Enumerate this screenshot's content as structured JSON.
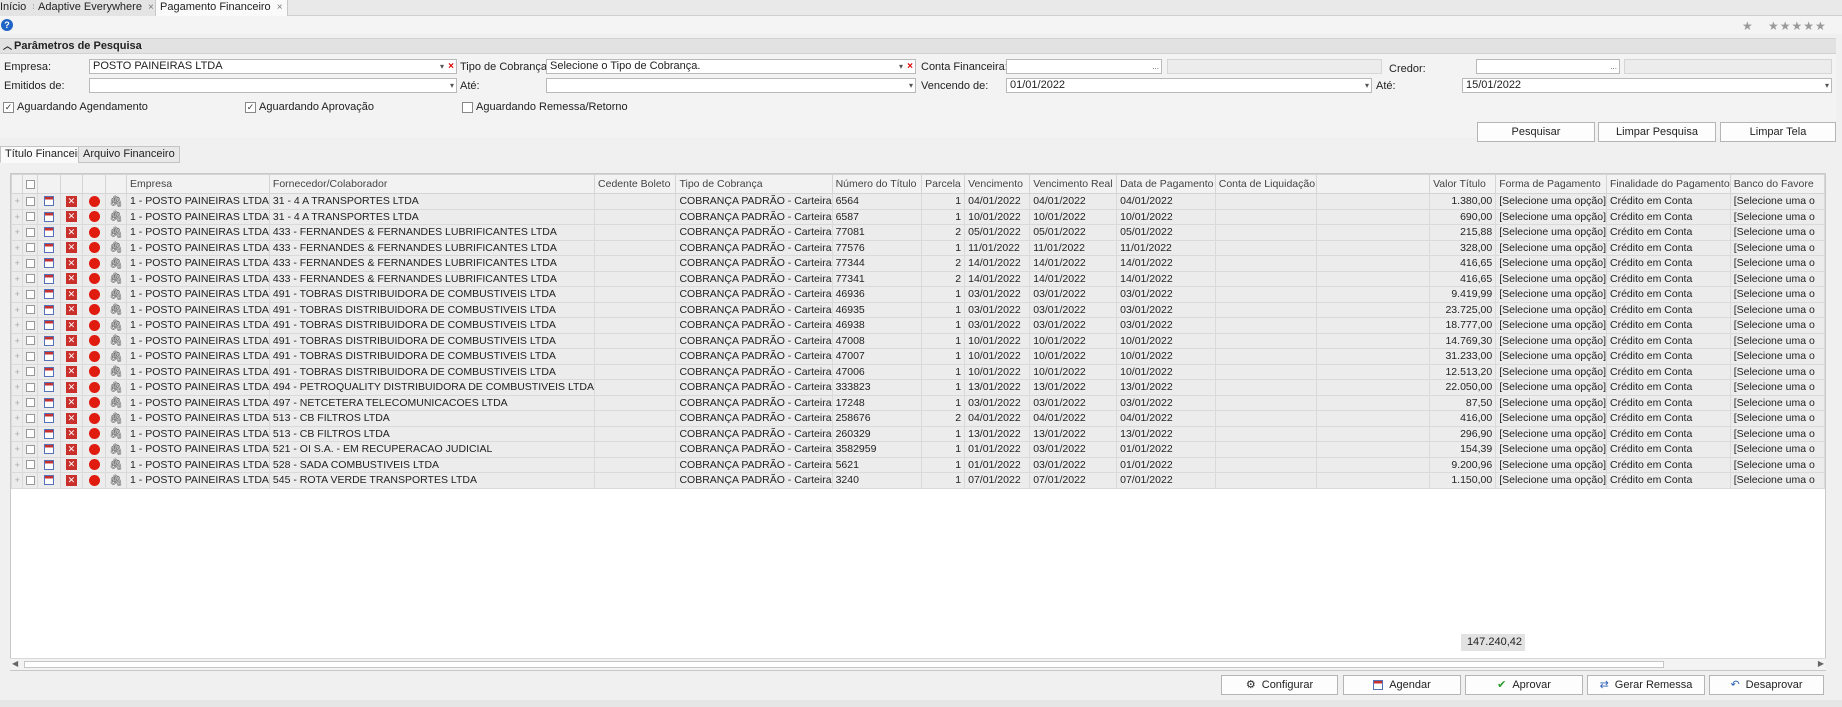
{
  "tabs": [
    {
      "label": "Início",
      "close": "×"
    },
    {
      "label": "Adaptive Everywhere",
      "close": "×"
    },
    {
      "label": "Pagamento Financeiro",
      "close": "×"
    }
  ],
  "toolbar": {
    "help": "?",
    "star_empty": "★",
    "rating": "★★★★★"
  },
  "panel": {
    "title": "Parâmetros de Pesquisa",
    "empresa_label": "Empresa:",
    "empresa_value": "POSTO PAINEIRAS LTDA",
    "tipo_cobranca_label": "Tipo de Cobrança:",
    "tipo_cobranca_placeholder": "Selecione o Tipo de Cobrança.",
    "conta_financeira_label": "Conta Financeira:",
    "conta_financeira_value": "",
    "credor_label": "Credor:",
    "credor_value": "",
    "emitidos_label": "Emitidos de:",
    "emitidos_value": "",
    "ate1_label": "Até:",
    "ate1_value": "",
    "vencendo_label": "Vencendo de:",
    "vencendo_value": "01/01/2022",
    "ate2_label": "Até:",
    "ate2_value": "15/01/2022",
    "chk_agendamento": "Aguardando Agendamento",
    "chk_aprovacao": "Aguardando Aprovação",
    "chk_remessa": "Aguardando Remessa/Retorno",
    "btn_pesquisar": "Pesquisar",
    "btn_limpar_pesquisa": "Limpar Pesquisa",
    "btn_limpar_tela": "Limpar Tela"
  },
  "subtabs": [
    "Título Financeiro",
    "Arquivo Financeiro"
  ],
  "grid": {
    "columns": [
      "Empresa",
      "Fornecedor/Colaborador",
      "Cedente Boleto",
      "Tipo de Cobrança",
      "Número do Título",
      "Parcela",
      "Vencimento",
      "Vencimento Real",
      "Data de Pagamento",
      "Conta de Liquidação",
      "",
      "Valor Título",
      "Forma de Pagamento",
      "Finalidade do Pagamento",
      "Banco do Favore"
    ],
    "rows": [
      [
        "1 - POSTO PAINEIRAS LTDA",
        "31 - 4 A TRANSPORTES LTDA",
        "",
        "COBRANÇA PADRÃO - Carteira",
        "6564",
        "1",
        "04/01/2022",
        "04/01/2022",
        "04/01/2022",
        "",
        "",
        "1.380,00",
        "[Selecione uma opção]",
        "Crédito em Conta",
        "[Selecione uma o"
      ],
      [
        "1 - POSTO PAINEIRAS LTDA",
        "31 - 4 A TRANSPORTES LTDA",
        "",
        "COBRANÇA PADRÃO - Carteira",
        "6587",
        "1",
        "10/01/2022",
        "10/01/2022",
        "10/01/2022",
        "",
        "",
        "690,00",
        "[Selecione uma opção]",
        "Crédito em Conta",
        "[Selecione uma o"
      ],
      [
        "1 - POSTO PAINEIRAS LTDA",
        "433 - FERNANDES & FERNANDES LUBRIFICANTES LTDA",
        "",
        "COBRANÇA PADRÃO - Carteira",
        "77081",
        "2",
        "05/01/2022",
        "05/01/2022",
        "05/01/2022",
        "",
        "",
        "215,88",
        "[Selecione uma opção]",
        "Crédito em Conta",
        "[Selecione uma o"
      ],
      [
        "1 - POSTO PAINEIRAS LTDA",
        "433 - FERNANDES & FERNANDES LUBRIFICANTES LTDA",
        "",
        "COBRANÇA PADRÃO - Carteira",
        "77576",
        "1",
        "11/01/2022",
        "11/01/2022",
        "11/01/2022",
        "",
        "",
        "328,00",
        "[Selecione uma opção]",
        "Crédito em Conta",
        "[Selecione uma o"
      ],
      [
        "1 - POSTO PAINEIRAS LTDA",
        "433 - FERNANDES & FERNANDES LUBRIFICANTES LTDA",
        "",
        "COBRANÇA PADRÃO - Carteira",
        "77344",
        "2",
        "14/01/2022",
        "14/01/2022",
        "14/01/2022",
        "",
        "",
        "416,65",
        "[Selecione uma opção]",
        "Crédito em Conta",
        "[Selecione uma o"
      ],
      [
        "1 - POSTO PAINEIRAS LTDA",
        "433 - FERNANDES & FERNANDES LUBRIFICANTES LTDA",
        "",
        "COBRANÇA PADRÃO - Carteira",
        "77341",
        "2",
        "14/01/2022",
        "14/01/2022",
        "14/01/2022",
        "",
        "",
        "416,65",
        "[Selecione uma opção]",
        "Crédito em Conta",
        "[Selecione uma o"
      ],
      [
        "1 - POSTO PAINEIRAS LTDA",
        "491 - TOBRAS DISTRIBUIDORA DE COMBUSTIVEIS LTDA",
        "",
        "COBRANÇA PADRÃO - Carteira",
        "46936",
        "1",
        "03/01/2022",
        "03/01/2022",
        "03/01/2022",
        "",
        "",
        "9.419,99",
        "[Selecione uma opção]",
        "Crédito em Conta",
        "[Selecione uma o"
      ],
      [
        "1 - POSTO PAINEIRAS LTDA",
        "491 - TOBRAS DISTRIBUIDORA DE COMBUSTIVEIS LTDA",
        "",
        "COBRANÇA PADRÃO - Carteira",
        "46935",
        "1",
        "03/01/2022",
        "03/01/2022",
        "03/01/2022",
        "",
        "",
        "23.725,00",
        "[Selecione uma opção]",
        "Crédito em Conta",
        "[Selecione uma o"
      ],
      [
        "1 - POSTO PAINEIRAS LTDA",
        "491 - TOBRAS DISTRIBUIDORA DE COMBUSTIVEIS LTDA",
        "",
        "COBRANÇA PADRÃO - Carteira",
        "46938",
        "1",
        "03/01/2022",
        "03/01/2022",
        "03/01/2022",
        "",
        "",
        "18.777,00",
        "[Selecione uma opção]",
        "Crédito em Conta",
        "[Selecione uma o"
      ],
      [
        "1 - POSTO PAINEIRAS LTDA",
        "491 - TOBRAS DISTRIBUIDORA DE COMBUSTIVEIS LTDA",
        "",
        "COBRANÇA PADRÃO - Carteira",
        "47008",
        "1",
        "10/01/2022",
        "10/01/2022",
        "10/01/2022",
        "",
        "",
        "14.769,30",
        "[Selecione uma opção]",
        "Crédito em Conta",
        "[Selecione uma o"
      ],
      [
        "1 - POSTO PAINEIRAS LTDA",
        "491 - TOBRAS DISTRIBUIDORA DE COMBUSTIVEIS LTDA",
        "",
        "COBRANÇA PADRÃO - Carteira",
        "47007",
        "1",
        "10/01/2022",
        "10/01/2022",
        "10/01/2022",
        "",
        "",
        "31.233,00",
        "[Selecione uma opção]",
        "Crédito em Conta",
        "[Selecione uma o"
      ],
      [
        "1 - POSTO PAINEIRAS LTDA",
        "491 - TOBRAS DISTRIBUIDORA DE COMBUSTIVEIS LTDA",
        "",
        "COBRANÇA PADRÃO - Carteira",
        "47006",
        "1",
        "10/01/2022",
        "10/01/2022",
        "10/01/2022",
        "",
        "",
        "12.513,20",
        "[Selecione uma opção]",
        "Crédito em Conta",
        "[Selecione uma o"
      ],
      [
        "1 - POSTO PAINEIRAS LTDA",
        "494 - PETROQUALITY DISTRIBUIDORA DE COMBUSTIVEIS LTDA",
        "",
        "COBRANÇA PADRÃO - Carteira",
        "333823",
        "1",
        "13/01/2022",
        "13/01/2022",
        "13/01/2022",
        "",
        "",
        "22.050,00",
        "[Selecione uma opção]",
        "Crédito em Conta",
        "[Selecione uma o"
      ],
      [
        "1 - POSTO PAINEIRAS LTDA",
        "497 - NETCETERA TELECOMUNICACOES LTDA",
        "",
        "COBRANÇA PADRÃO - Carteira",
        "17248",
        "1",
        "03/01/2022",
        "03/01/2022",
        "03/01/2022",
        "",
        "",
        "87,50",
        "[Selecione uma opção]",
        "Crédito em Conta",
        "[Selecione uma o"
      ],
      [
        "1 - POSTO PAINEIRAS LTDA",
        "513 - CB FILTROS LTDA",
        "",
        "COBRANÇA PADRÃO - Carteira",
        "258676",
        "2",
        "04/01/2022",
        "04/01/2022",
        "04/01/2022",
        "",
        "",
        "416,00",
        "[Selecione uma opção]",
        "Crédito em Conta",
        "[Selecione uma o"
      ],
      [
        "1 - POSTO PAINEIRAS LTDA",
        "513 - CB FILTROS LTDA",
        "",
        "COBRANÇA PADRÃO - Carteira",
        "260329",
        "1",
        "13/01/2022",
        "13/01/2022",
        "13/01/2022",
        "",
        "",
        "296,90",
        "[Selecione uma opção]",
        "Crédito em Conta",
        "[Selecione uma o"
      ],
      [
        "1 - POSTO PAINEIRAS LTDA",
        "521 - OI S.A. - EM RECUPERACAO JUDICIAL",
        "",
        "COBRANÇA PADRÃO - Carteira",
        "3582959",
        "1",
        "01/01/2022",
        "03/01/2022",
        "01/01/2022",
        "",
        "",
        "154,39",
        "[Selecione uma opção]",
        "Crédito em Conta",
        "[Selecione uma o"
      ],
      [
        "1 - POSTO PAINEIRAS LTDA",
        "528 - SADA COMBUSTIVEIS LTDA",
        "",
        "COBRANÇA PADRÃO - Carteira",
        "5621",
        "1",
        "01/01/2022",
        "03/01/2022",
        "01/01/2022",
        "",
        "",
        "9.200,96",
        "[Selecione uma opção]",
        "Crédito em Conta",
        "[Selecione uma o"
      ],
      [
        "1 - POSTO PAINEIRAS LTDA",
        "545 - ROTA VERDE TRANSPORTES LTDA",
        "",
        "COBRANÇA PADRÃO - Carteira",
        "3240",
        "1",
        "07/01/2022",
        "07/01/2022",
        "07/01/2022",
        "",
        "",
        "1.150,00",
        "[Selecione uma opção]",
        "Crédito em Conta",
        "[Selecione uma o"
      ]
    ],
    "total": "147.240,42"
  },
  "icons": {
    "expand": "+",
    "close": "✕",
    "clip": "🖇",
    "dropdown": "▾",
    "clear": "×",
    "ellipsis": "..."
  },
  "actions": {
    "configurar": "Configurar",
    "agendar": "Agendar",
    "aprovar": "Aprovar",
    "gerar_remessa": "Gerar Remessa",
    "desaprovar": "Desaprovar"
  }
}
